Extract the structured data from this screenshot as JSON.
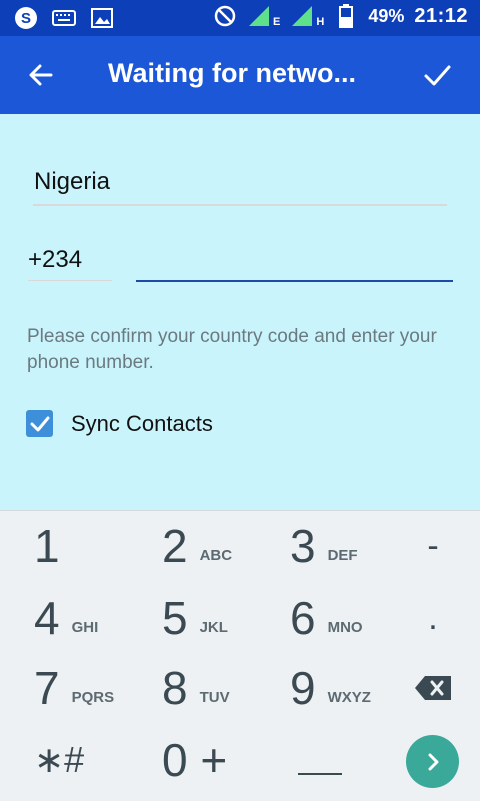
{
  "status_bar": {
    "battery": "49%",
    "time": "21:12",
    "network_e": "E",
    "network_h": "H",
    "icons": [
      "app-s-icon",
      "keyboard-icon",
      "image-icon",
      "do-not-disturb-icon",
      "signal-icon",
      "battery-icon"
    ]
  },
  "app_bar": {
    "title": "Waiting for netwo...",
    "back_icon": "arrow-left-icon",
    "done_icon": "check-icon"
  },
  "form": {
    "country": "Nigeria",
    "country_code": "+234",
    "phone_value": "",
    "hint": "Please confirm your country code and enter your phone number.",
    "sync_label": "Sync Contacts",
    "sync_checked": true
  },
  "keypad": {
    "keys": [
      {
        "digit": "1",
        "letters": ""
      },
      {
        "digit": "2",
        "letters": "ABC"
      },
      {
        "digit": "3",
        "letters": "DEF"
      },
      {
        "digit": "4",
        "letters": "GHI"
      },
      {
        "digit": "5",
        "letters": "JKL"
      },
      {
        "digit": "6",
        "letters": "MNO"
      },
      {
        "digit": "7",
        "letters": "PQRS"
      },
      {
        "digit": "8",
        "letters": "TUV"
      },
      {
        "digit": "9",
        "letters": "WXYZ"
      },
      {
        "digit": "∗#",
        "letters": ""
      },
      {
        "digit": "0 +",
        "letters": ""
      }
    ],
    "dash": "-",
    "dot": ".",
    "colors": {
      "accent": "#3aa99a",
      "primary": "#1b57d6",
      "status": "#0d3fb8"
    }
  }
}
